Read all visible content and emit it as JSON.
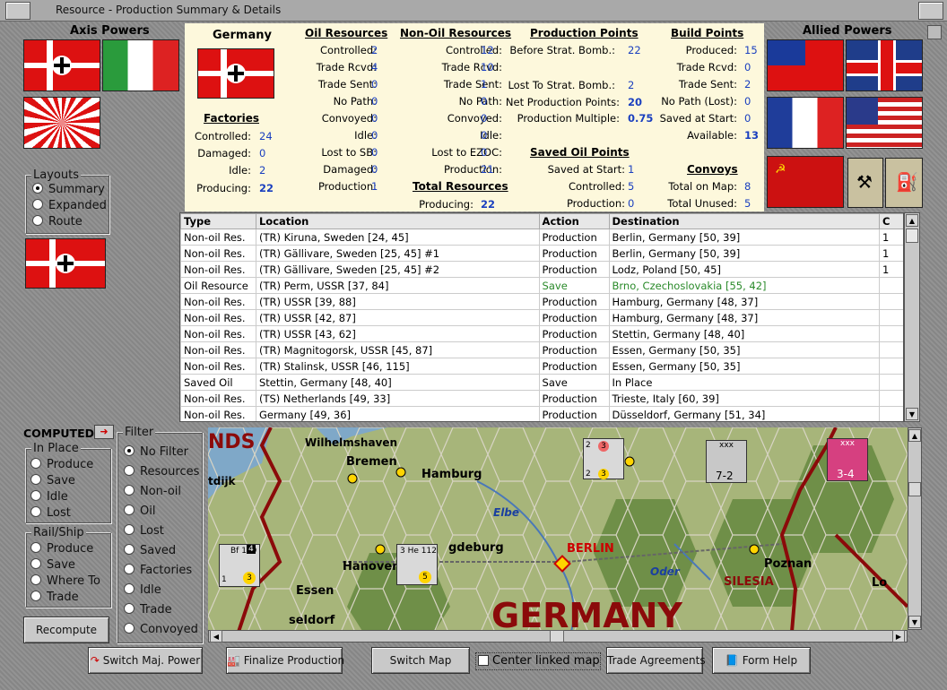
{
  "window": {
    "title": "Resource - Production Summary & Details"
  },
  "axis": {
    "header": "Axis Powers"
  },
  "allied": {
    "header": "Allied Powers"
  },
  "layouts": {
    "title": "Layouts",
    "options": [
      "Summary",
      "Expanded",
      "Route"
    ],
    "selected": "Summary"
  },
  "summary": {
    "country": "Germany",
    "factories": {
      "header": "Factories",
      "rows": [
        {
          "label": "Controlled:",
          "value": "24"
        },
        {
          "label": "Damaged:",
          "value": "0"
        },
        {
          "label": "Idle:",
          "value": "2"
        },
        {
          "label": "Producing:",
          "value": "22"
        }
      ]
    },
    "oil": {
      "header": "Oil Resources",
      "rows": [
        {
          "label": "Controlled:",
          "value": "2"
        },
        {
          "label": "Trade Rcvd:",
          "value": "4"
        },
        {
          "label": "Trade Sent:",
          "value": "0"
        },
        {
          "label": "No Path:",
          "value": "0"
        },
        {
          "label": "Convoyed:",
          "value": "0"
        },
        {
          "label": "Idle:",
          "value": "0"
        },
        {
          "label": "Lost to SB:",
          "value": "0"
        },
        {
          "label": "Damaged:",
          "value": "0"
        },
        {
          "label": "Production:",
          "value": "1"
        }
      ]
    },
    "nonoil": {
      "header": "Non-Oil Resources",
      "rows": [
        {
          "label": "Controlled:",
          "value": "12"
        },
        {
          "label": "Trade Rcvd:",
          "value": "10"
        },
        {
          "label": "Trade Sent:",
          "value": "1"
        },
        {
          "label": "No Path:",
          "value": "0"
        },
        {
          "label": "Convoyed:",
          "value": "0"
        },
        {
          "label": "Idle:",
          "value": "0"
        },
        {
          "label": "Lost to EZOC:",
          "value": "0"
        },
        {
          "label": "Production:",
          "value": "21"
        }
      ]
    },
    "total": {
      "header": "Total Resources",
      "label": "Producing:",
      "value": "22"
    },
    "pp": {
      "header": "Production Points",
      "rows": [
        {
          "label": "Before Strat. Bomb.:",
          "value": "22"
        },
        {
          "label": "Lost To Strat. Bomb.:",
          "value": "2"
        },
        {
          "label": "Net Production Points:",
          "value": "20"
        },
        {
          "label": "Production Multiple:",
          "value": "0.75"
        }
      ]
    },
    "savedoil": {
      "header": "Saved Oil Points",
      "rows": [
        {
          "label": "Saved at Start:",
          "value": "1"
        },
        {
          "label": "Controlled:",
          "value": "5"
        },
        {
          "label": "Production:",
          "value": "0"
        }
      ]
    },
    "bp": {
      "header": "Build Points",
      "rows": [
        {
          "label": "Produced:",
          "value": "15"
        },
        {
          "label": "Trade Rcvd:",
          "value": "0"
        },
        {
          "label": "Trade Sent:",
          "value": "2"
        },
        {
          "label": "No Path (Lost):",
          "value": "0"
        },
        {
          "label": "Saved at Start:",
          "value": "0"
        },
        {
          "label": "Available:",
          "value": "13"
        }
      ]
    },
    "convoys": {
      "header": "Convoys",
      "rows": [
        {
          "label": "Total on Map:",
          "value": "8"
        },
        {
          "label": "Total Unused:",
          "value": "5"
        }
      ]
    }
  },
  "table": {
    "columns": [
      "Type",
      "Location",
      "Action",
      "Destination",
      "C"
    ],
    "rows": [
      [
        "Non-oil Res.",
        "(TR) Kiruna, Sweden [24, 45]",
        "Production",
        "Berlin, Germany [50, 39]",
        "1"
      ],
      [
        "Non-oil Res.",
        "(TR) Gällivare, Sweden [25, 45] #1",
        "Production",
        "Berlin, Germany [50, 39]",
        "1"
      ],
      [
        "Non-oil Res.",
        "(TR) Gällivare, Sweden [25, 45] #2",
        "Production",
        "Lodz, Poland [50, 45]",
        "1"
      ],
      [
        "Oil Resource",
        "(TR) Perm, USSR [37, 84]",
        "Save",
        "Brno, Czechoslovakia [55, 42]",
        ""
      ],
      [
        "Non-oil Res.",
        "(TR) USSR [39, 88]",
        "Production",
        "Hamburg, Germany [48, 37]",
        ""
      ],
      [
        "Non-oil Res.",
        "(TR) USSR [42, 87]",
        "Production",
        "Hamburg, Germany [48, 37]",
        ""
      ],
      [
        "Non-oil Res.",
        "(TR) USSR [43, 62]",
        "Production",
        "Stettin, Germany [48, 40]",
        ""
      ],
      [
        "Non-oil Res.",
        "(TR) Magnitogorsk, USSR [45, 87]",
        "Production",
        "Essen, Germany [50, 35]",
        ""
      ],
      [
        "Non-oil Res.",
        "(TR) Stalinsk, USSR [46, 115]",
        "Production",
        "Essen, Germany [50, 35]",
        ""
      ],
      [
        "Saved Oil",
        "Stettin, Germany [48, 40]",
        "Save",
        "In Place",
        ""
      ],
      [
        "Non-oil Res.",
        "(TS) Netherlands [49, 33]",
        "Production",
        "Trieste, Italy [60, 39]",
        ""
      ],
      [
        "Non-oil Res.",
        "Germany [49, 36]",
        "Production",
        "Düsseldorf, Germany [51, 34]",
        ""
      ]
    ]
  },
  "computed": {
    "label": "COMPUTED",
    "inplace": {
      "title": "In Place",
      "options": [
        "Produce",
        "Save",
        "Idle",
        "Lost"
      ]
    },
    "railship": {
      "title": "Rail/Ship",
      "options": [
        "Produce",
        "Save",
        "Where To",
        "Trade"
      ]
    },
    "recompute": "Recompute"
  },
  "filter": {
    "title": "Filter",
    "options": [
      "No Filter",
      "Resources",
      "Non-oil",
      "Oil",
      "Lost",
      "Saved",
      "Factories",
      "Idle",
      "Trade",
      "Convoyed"
    ],
    "selected": "No Filter"
  },
  "map": {
    "labels": {
      "nds": "NDS",
      "wilhelmshaven": "Wilhelmshaven",
      "bremen": "Bremen",
      "hamburg": "Hamburg",
      "dijk": "tdijk",
      "elbe": "Elbe",
      "berlin": "BERLIN",
      "magdeburg": "gdeburg",
      "hanover": "Hanover",
      "essen": "Essen",
      "oder": "Oder",
      "poznan": "Poznan",
      "silesia": "SILESIA",
      "germany": "GERMANY",
      "seldorf": "seldorf",
      "lo": "Lo"
    },
    "counters": {
      "air1": {
        "top": "Bf 109",
        "a": "4",
        "b": "1",
        "c": "3"
      },
      "air2": {
        "top": "3 He 112",
        "c": "5"
      },
      "naval": {
        "a": "2",
        "b": "3",
        "c": "2",
        "d": "3"
      },
      "corps": {
        "top": "xxx",
        "value": "7-2"
      },
      "red": {
        "top": "xxx",
        "value": "3-4"
      }
    }
  },
  "buttons": {
    "switch_power": "Switch Maj. Power",
    "finalize": "Finalize Production",
    "switch_map": "Switch Map",
    "center_map": "Center linked map",
    "trade": "Trade Agreements",
    "form_help": "Form Help"
  },
  "colors": {
    "summary_bg": "#fdf8dc",
    "value_blue": "#1a3fbf",
    "save_green": "#2a8a2a",
    "map_red": "#8b0a0a"
  }
}
